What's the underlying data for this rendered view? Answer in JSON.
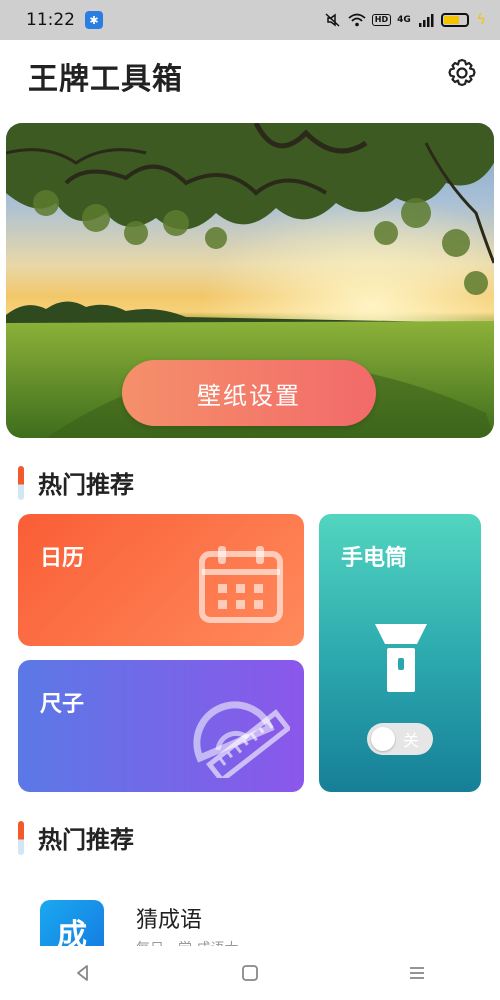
{
  "status_bar": {
    "time": "11:22",
    "network_label": "HD",
    "signal_label": "4G"
  },
  "header": {
    "title": "王牌工具箱",
    "settings_icon": "gear-icon"
  },
  "banner": {
    "button_label": "壁纸设置"
  },
  "sections": [
    {
      "title": "热门推荐"
    },
    {
      "title": "热门推荐"
    }
  ],
  "cards": {
    "calendar": {
      "label": "日历",
      "icon": "calendar-icon"
    },
    "ruler": {
      "label": "尺子",
      "icon": "ruler-icon"
    },
    "flashlight": {
      "label": "手电筒",
      "icon": "flashlight-icon",
      "toggle_label": "关",
      "toggle_on": false
    }
  },
  "list": [
    {
      "icon_text": "成",
      "title": "猜成语",
      "subtitle": "每日一学 成语大"
    }
  ],
  "colors": {
    "accent_orange": "#fa5e36",
    "accent_purple": "#8b57ea",
    "accent_teal": "#2aa6ad",
    "banner_button": "#f26a6a"
  }
}
